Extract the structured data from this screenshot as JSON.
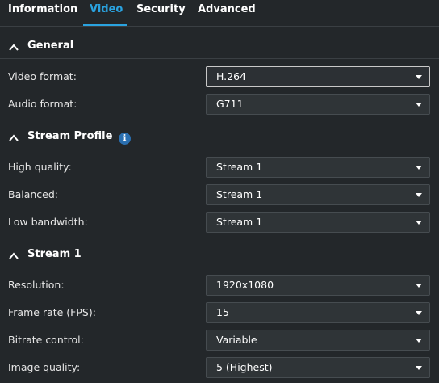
{
  "tabs": [
    {
      "label": "Information"
    },
    {
      "label": "Video"
    },
    {
      "label": "Security"
    },
    {
      "label": "Advanced"
    }
  ],
  "active_tab": "Video",
  "accent_color": "#2aa3e0",
  "sections": {
    "general": {
      "title": "General",
      "video_format": {
        "label": "Video format:",
        "value": "H.264"
      },
      "audio_format": {
        "label": "Audio format:",
        "value": "G711"
      }
    },
    "stream_profile": {
      "title": "Stream Profile",
      "info_icon": "i",
      "high_quality": {
        "label": "High quality:",
        "value": "Stream 1"
      },
      "balanced": {
        "label": "Balanced:",
        "value": "Stream 1"
      },
      "low_bandwidth": {
        "label": "Low bandwidth:",
        "value": "Stream 1"
      }
    },
    "stream1": {
      "title": "Stream 1",
      "resolution": {
        "label": "Resolution:",
        "value": "1920x1080"
      },
      "frame_rate": {
        "label": "Frame rate (FPS):",
        "value": "15"
      },
      "bitrate_control": {
        "label": "Bitrate control:",
        "value": "Variable"
      },
      "image_quality": {
        "label": "Image quality:",
        "value": "5 (Highest)"
      }
    }
  }
}
